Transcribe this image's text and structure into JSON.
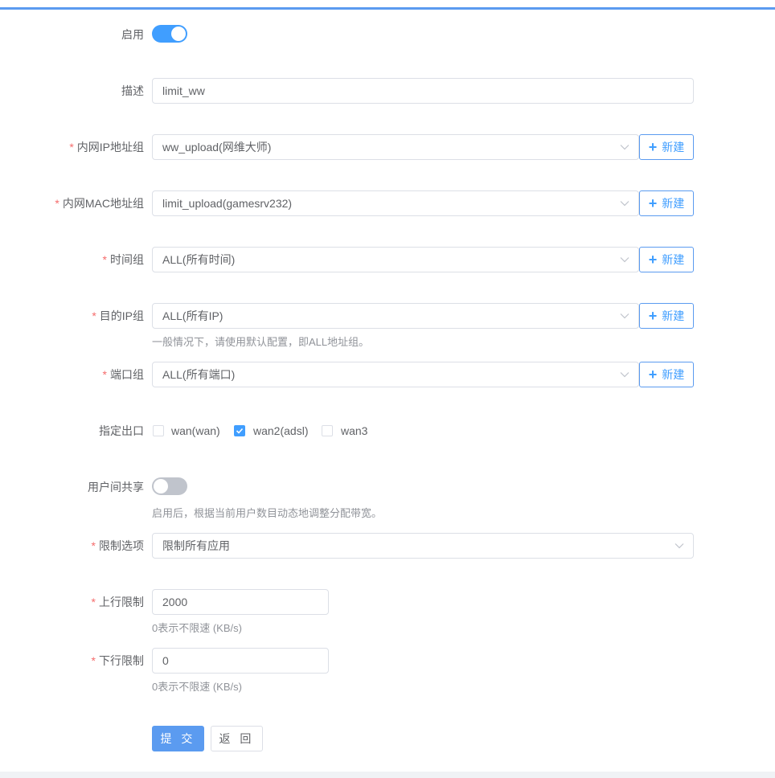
{
  "form": {
    "enable": {
      "label": "启用",
      "value": true
    },
    "description": {
      "label": "描述",
      "value": "limit_ww"
    },
    "lan_ip_group": {
      "label": "内网IP地址组",
      "value": "ww_upload(网维大师)",
      "new_label": "新建"
    },
    "lan_mac_group": {
      "label": "内网MAC地址组",
      "value": "limit_upload(gamesrv232)",
      "new_label": "新建"
    },
    "time_group": {
      "label": "时间组",
      "value": "ALL(所有时间)",
      "new_label": "新建"
    },
    "dest_ip_group": {
      "label": "目的IP组",
      "value": "ALL(所有IP)",
      "new_label": "新建",
      "hint": "一般情况下，请使用默认配置，即ALL地址组。"
    },
    "port_group": {
      "label": "端口组",
      "value": "ALL(所有端口)",
      "new_label": "新建"
    },
    "egress": {
      "label": "指定出口",
      "options": [
        {
          "label": "wan(wan)",
          "checked": false
        },
        {
          "label": "wan2(adsl)",
          "checked": true
        },
        {
          "label": "wan3",
          "checked": false
        }
      ]
    },
    "share": {
      "label": "用户间共享",
      "value": false,
      "hint": "启用后，根据当前用户数目动态地调整分配带宽。"
    },
    "limit_option": {
      "label": "限制选项",
      "value": "限制所有应用"
    },
    "upload_limit": {
      "label": "上行限制",
      "value": "2000",
      "hint": "0表示不限速 (KB/s)"
    },
    "download_limit": {
      "label": "下行限制",
      "value": "0",
      "hint": "0表示不限速 (KB/s)"
    }
  },
  "actions": {
    "submit": "提 交",
    "back": "返 回"
  },
  "colors": {
    "primary": "#409eff",
    "required": "#f56c6c",
    "border": "#dcdfe6"
  }
}
